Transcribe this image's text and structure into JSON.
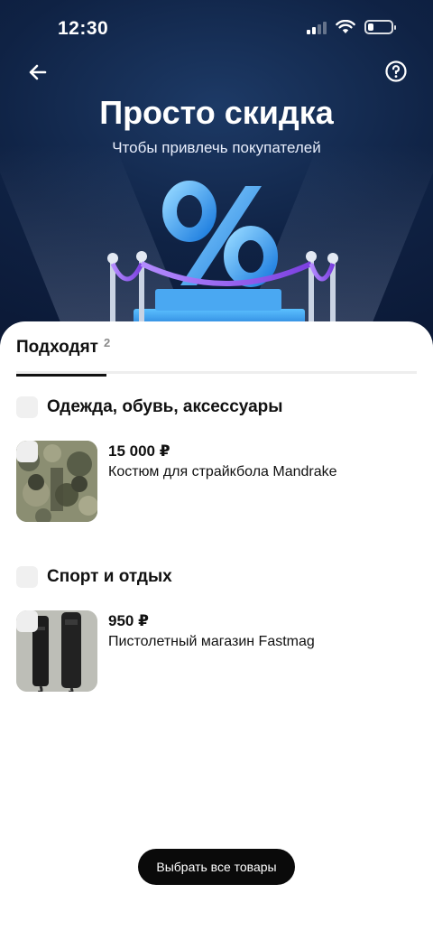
{
  "status_bar": {
    "time": "12:30"
  },
  "header": {
    "title": "Просто скидка",
    "subtitle": "Чтобы привлечь покупателей"
  },
  "tabs": [
    {
      "label": "Подходят",
      "count": "2",
      "active": true
    }
  ],
  "categories": [
    {
      "label": "Одежда, обувь, аксессуары",
      "products": [
        {
          "price": "15 000 ₽",
          "name": "Костюм для страйкбола Mandrake"
        }
      ]
    },
    {
      "label": "Спорт и отдых",
      "products": [
        {
          "price": "950 ₽",
          "name": "Пистолетный магазин Fastmag"
        }
      ]
    }
  ],
  "actions": {
    "select_all": "Выбрать все товары"
  },
  "colors": {
    "hero_bg": "#0f2244",
    "accent_blue": "#3aa7f0",
    "rope_purple": "#9b5cf0",
    "button_bg": "#0a0a0a",
    "checkbox_bg": "#f0f0f0"
  },
  "icons": {
    "back": "arrow-left-icon",
    "help": "question-circle-icon",
    "signal": "cellular-signal-icon",
    "wifi": "wifi-icon",
    "battery": "battery-icon"
  }
}
